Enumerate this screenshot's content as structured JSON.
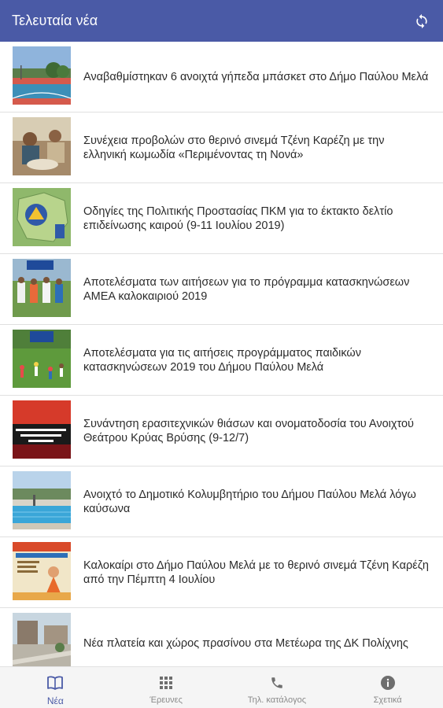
{
  "appbar": {
    "title": "Τελευταία νέα",
    "refresh_icon": "refresh-icon",
    "color": "#4a5aa6"
  },
  "news": [
    {
      "headline": "Αναβαθμίστηκαν 6 ανοιχτά γήπεδα μπάσκετ στο Δήμο Παύλου Μελά",
      "thumb": "basketball-court"
    },
    {
      "headline": "Συνέχεια προβολών στο θερινό σινεμά Τζένη Καρέζη με την ελληνική κωμωδία «Περιμένοντας τη Νονά»",
      "thumb": "cinema-scene"
    },
    {
      "headline": "Οδηγίες της Πολιτικής Προστασίας ΠΚΜ για το έκτακτο δελτίο επιδείνωσης καιρού (9-11 Ιουλίου 2019)",
      "thumb": "civil-protection-map"
    },
    {
      "headline": "Αποτελέσματα των αιτήσεων για το πρόγραμμα κατασκηνώσεων ΑΜΕΑ καλοκαιριού 2019",
      "thumb": "camp-group"
    },
    {
      "headline": "Αποτελέσματα για τις αιτήσεις προγράμματος παιδικών κατασκηνώσεων 2019 του Δήμου Παύλου Μελά",
      "thumb": "children-camp"
    },
    {
      "headline": "Συνάντηση ερασιτεχνικών θιάσων και ονοματοδοσία του Ανοιχτού Θεάτρου Κρύας Βρύσης (9-12/7)",
      "thumb": "theater-poster"
    },
    {
      "headline": "Ανοιχτό το Δημοτικό Κολυμβητήριο του Δήμου Παύλου Μελά λόγω καύσωνα",
      "thumb": "swimming-pool"
    },
    {
      "headline": "Καλοκαίρι στο Δήμο Παύλου Μελά με το θερινό σινεμά Τζένη Καρέζη από την Πέμπτη 4 Ιουλίου",
      "thumb": "cinema-poster"
    },
    {
      "headline": "Νέα πλατεία και χώρος πρασίνου στα Μετέωρα της ΔΚ Πολίχνης",
      "thumb": "square-photo"
    }
  ],
  "bottom_nav": [
    {
      "label": "Νέα",
      "icon": "book-icon",
      "active": true
    },
    {
      "label": "Έρευνες",
      "icon": "grid-icon",
      "active": false
    },
    {
      "label": "Τηλ. κατάλογος",
      "icon": "phone-icon",
      "active": false
    },
    {
      "label": "Σχετικά",
      "icon": "info-icon",
      "active": false
    }
  ]
}
